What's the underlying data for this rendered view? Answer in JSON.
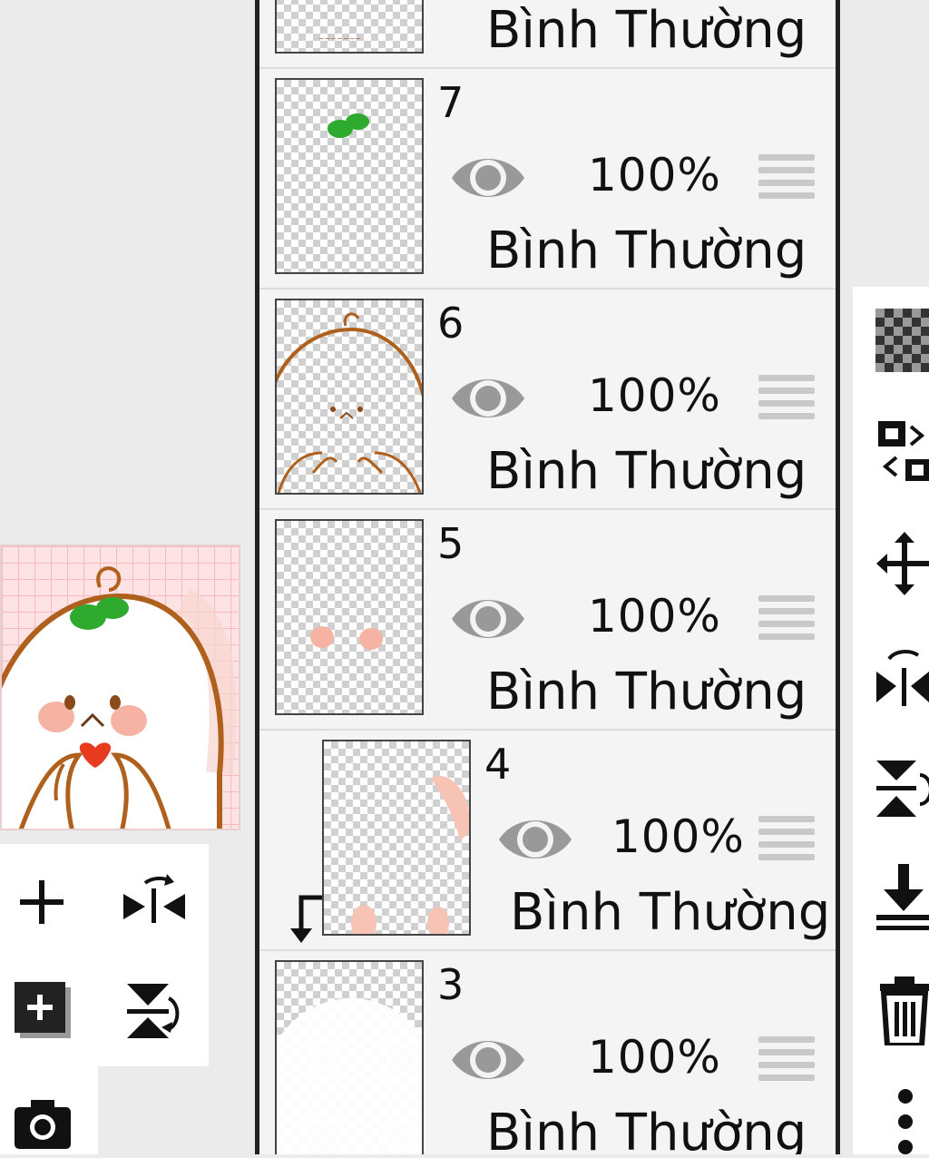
{
  "layers": [
    {
      "number": "",
      "opacity": "",
      "blend": "Bình Thường"
    },
    {
      "number": "7",
      "opacity": "100%",
      "blend": "Bình Thường"
    },
    {
      "number": "6",
      "opacity": "100%",
      "blend": "Bình Thường"
    },
    {
      "number": "5",
      "opacity": "100%",
      "blend": "Bình Thường"
    },
    {
      "number": "4",
      "opacity": "100%",
      "blend": "Bình Thường"
    },
    {
      "number": "3",
      "opacity": "100%",
      "blend": "Bình Thường"
    }
  ],
  "icons": {
    "visibility": "eye-icon",
    "reorder": "drag-handle-icon",
    "clip": "clipping-arrow-icon",
    "add_layer": "plus-icon",
    "add_layer_copy": "add-layer-box-icon",
    "flip_h": "flip-horizontal-icon",
    "flip_v": "flip-vertical-icon",
    "camera": "camera-icon",
    "transparency": "checker-icon",
    "transform": "transform-icon",
    "move": "move-icon",
    "delete": "trash-icon",
    "download": "merge-down-icon",
    "more": "more-vertical-icon"
  },
  "colors": {
    "panel_border": "#222222",
    "line_brown": "#b0601d",
    "leaf_green": "#2eaa2e",
    "blush": "#f6b3a3"
  }
}
